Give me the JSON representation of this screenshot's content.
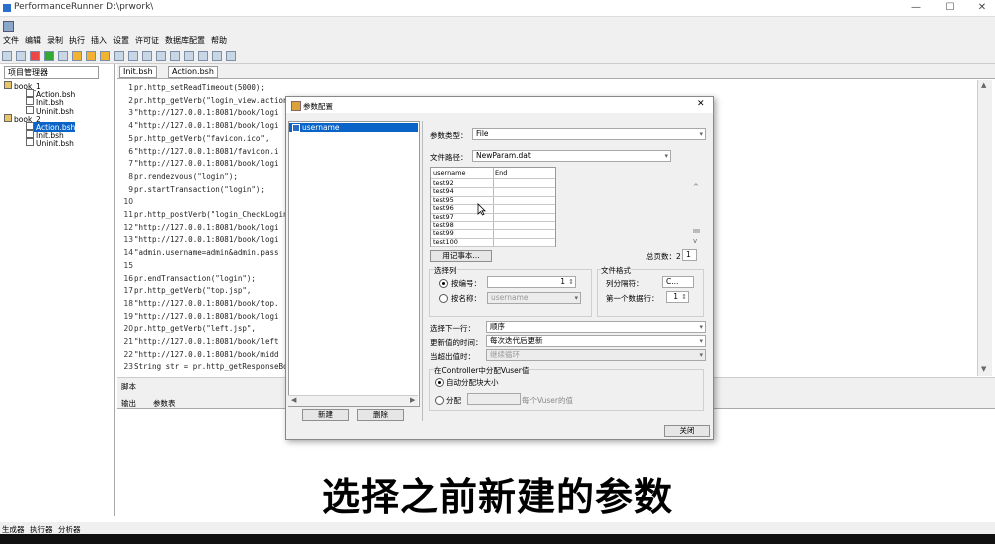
{
  "window": {
    "title": "PerformanceRunner  D:\\prwork\\",
    "minimize": "—",
    "maximize": "☐",
    "close": "✕"
  },
  "menu": [
    "文件",
    "编辑",
    "录制",
    "执行",
    "插入",
    "设置",
    "许可证",
    "数据库配置",
    "帮助"
  ],
  "left_panel": {
    "tab": "项目管理器",
    "tree": [
      {
        "label": "book_1",
        "indent": 0,
        "selected": false
      },
      {
        "label": "Action.bsh",
        "indent": 1,
        "selected": false
      },
      {
        "label": "Init.bsh",
        "indent": 1,
        "selected": false
      },
      {
        "label": "Uninit.bsh",
        "indent": 1,
        "selected": false
      },
      {
        "label": "book_2",
        "indent": 0,
        "selected": false
      },
      {
        "label": "Action.bsh",
        "indent": 1,
        "selected": true
      },
      {
        "label": "Init.bsh",
        "indent": 1,
        "selected": false
      },
      {
        "label": "Uninit.bsh",
        "indent": 1,
        "selected": false
      }
    ]
  },
  "editor": {
    "tabs": [
      "Init.bsh",
      "Action.bsh"
    ],
    "lines": [
      {
        "n": "1",
        "t": "pr.http_setReadTimeout(5000);"
      },
      {
        "n": "2",
        "t": "pr.http_getVerb(\"login_view.action\","
      },
      {
        "n": "3",
        "t": "    \"http://127.0.0.1:8081/book/logi"
      },
      {
        "n": "4",
        "t": "    \"http://127.0.0.1:8081/book/logi"
      },
      {
        "n": "5",
        "t": "pr.http_getVerb(\"favicon.ico\","
      },
      {
        "n": "6",
        "t": "    \"http://127.0.0.1:8081/favicon.i"
      },
      {
        "n": "7",
        "t": "    \"http://127.0.0.1:8081/book/logi"
      },
      {
        "n": "8",
        "t": "pr.rendezvous(\"login\");"
      },
      {
        "n": "9",
        "t": "pr.startTransaction(\"login\");"
      },
      {
        "n": "10",
        "t": ""
      },
      {
        "n": "11",
        "t": "pr.http_postVerb(\"login_CheckLogin.a"
      },
      {
        "n": "12",
        "t": "    \"http://127.0.0.1:8081/book/logi"
      },
      {
        "n": "13",
        "t": "    \"http://127.0.0.1:8081/book/logi"
      },
      {
        "n": "14",
        "t": "    \"admin.username=admin&admin.pass"
      },
      {
        "n": "15",
        "t": ""
      },
      {
        "n": "16",
        "t": "pr.endTransaction(\"login\");"
      },
      {
        "n": "17",
        "t": "pr.http_getVerb(\"top.jsp\","
      },
      {
        "n": "18",
        "t": "    \"http://127.0.0.1:8081/book/top."
      },
      {
        "n": "19",
        "t": "    \"http://127.0.0.1:8081/book/logi"
      },
      {
        "n": "20",
        "t": "pr.http_getVerb(\"left.jsp\","
      },
      {
        "n": "21",
        "t": "    \"http://127.0.0.1:8081/book/left"
      },
      {
        "n": "22",
        "t": "    \"http://127.0.0.1:8081/book/midd"
      },
      {
        "n": "23",
        "t": "String str = pr.http_getResponseBody"
      }
    ],
    "script_label": "脚本"
  },
  "bottom_tabs": [
    "输出",
    "参数表"
  ],
  "status_tabs": [
    "生成器",
    "执行器",
    "分析器"
  ],
  "dialog": {
    "title": "参数配置",
    "close": "✕",
    "param_list": [
      "username"
    ],
    "new_button": "新建",
    "delete_button": "删除",
    "param_type_label": "参数类型：",
    "param_type_value": "File",
    "file_path_label": "文件路径：",
    "file_path_value": "NewParam.dat",
    "grid_headers": [
      "username",
      "End"
    ],
    "grid_rows": [
      "test92",
      "test94",
      "test95",
      "test96",
      "test97",
      "test98",
      "test99",
      "test100"
    ],
    "notepad_button": "用记事本...",
    "total_cols_label": "总页数：2",
    "total_cols_value": "1",
    "select_col_group": "选择列",
    "by_number_label": "按编号：",
    "by_number_value": "1",
    "by_name_label": "按名称：",
    "by_name_value": "username",
    "file_format_group": "文件格式",
    "col_sep_label": "列分隔符：",
    "col_sep_value": "C...",
    "first_row_label": "第一个数据行：",
    "first_row_value": "1",
    "next_row_label": "选择下一行：",
    "next_row_value": "顺序",
    "update_label": "更新值的时间：",
    "update_value": "每次迭代后更新",
    "out_of_values_label": "当超出值时：",
    "out_of_values_value": "继续循环",
    "vuser_group": "在Controller中分配Vuser值",
    "auto_alloc_label": "自动分配块大小",
    "alloc_label": "分配",
    "per_vuser_label": "每个Vuser的值",
    "close_button": "关闭"
  },
  "caption": "选择之前新建的参数"
}
